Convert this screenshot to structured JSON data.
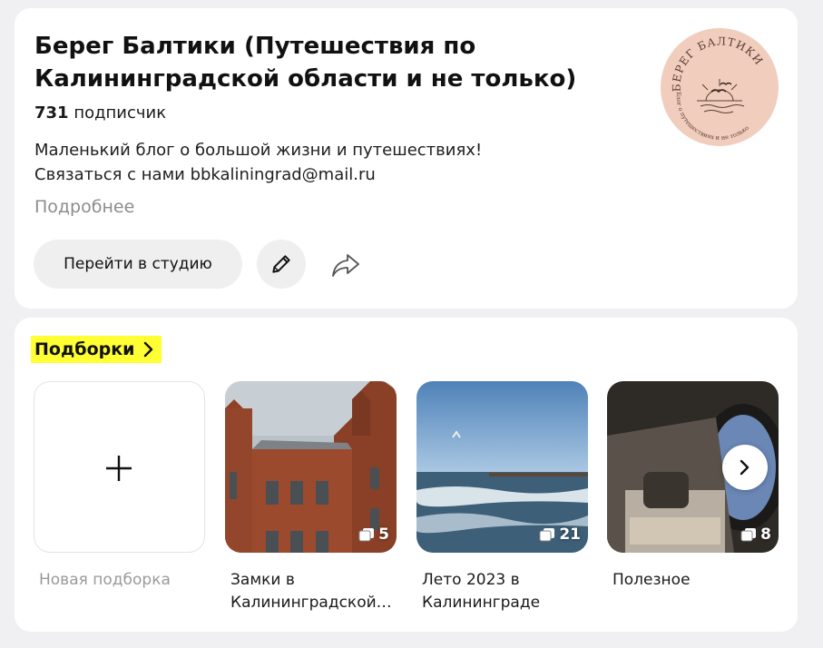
{
  "channel": {
    "title": "Берег Балтики (Путешествия по Калининградской области и не только)",
    "subscribers_count": "731",
    "subscribers_label": "подписчик",
    "description_line1": "Маленький блог о большой жизни и путешествиях!",
    "description_line2": "Связаться с нами bbkaliningrad@mail.ru",
    "more_label": "Подробнее",
    "studio_button": "Перейти в студию",
    "avatar_text_top": "БЕРЕГ БАЛТИКИ",
    "avatar_text_bottom": "Блог о путешествиях и не только"
  },
  "collections": {
    "heading": "Подборки",
    "new_label": "Новая подборка",
    "items": [
      {
        "title": "Замки в Калининградской области",
        "count": "5"
      },
      {
        "title": "Лето 2023 в Калининграде",
        "count": "21"
      },
      {
        "title": "Полезное",
        "count": "8"
      }
    ]
  },
  "colors": {
    "highlight": "#ffff33",
    "avatar_bg": "#f1cdbd",
    "page_bg": "#f0f0f3"
  }
}
